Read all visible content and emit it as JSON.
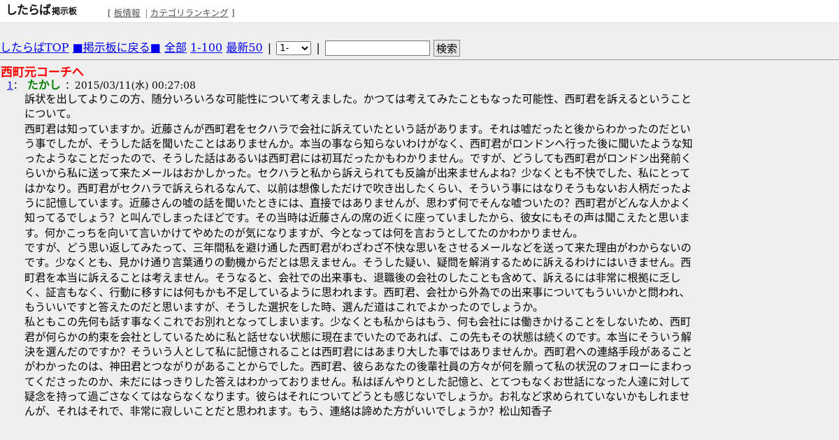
{
  "header": {
    "logo_main": "したらば",
    "logo_sub": "掲示板",
    "bracket_open": "[",
    "bracket_close": "]",
    "link_board_info": "板情報",
    "separator": "|",
    "link_category_ranking": "カテゴリランキング"
  },
  "nav": {
    "top": "したらばTOP",
    "back": "■掲示板に戻る■",
    "all": "全部",
    "range": "1-100",
    "latest": "最新50",
    "pipe": "|",
    "select_value": "1-",
    "search_value": "",
    "search_button": "検索"
  },
  "thread": {
    "title": "西町元コーチへ",
    "post": {
      "number": "1",
      "colon": "：",
      "name": "たかし",
      "datetime": "：2015/03/11(水) 00:27:08",
      "body": "訴状を出してよりこの方、随分いろいろな可能性について考えました。かつては考えてみたこともなった可能性、西町君を訴えるということについて。\n西町君は知っていますか。近藤さんが西町君をセクハラで会社に訴えていたという話があります。それは嘘だったと後からわかったのだという事でしたが、そうした話を聞いたことはありませんか。本当の事なら知らないわけがなく、西町君がロンドンへ行った後に聞いたような知ったようなことだったので、そうした話はあるいは西町君には初耳だったかもわかりません。ですが、どうしても西町君がロンドン出発前くらいから私に送って来たメールはおかしかった。セクハラと私から訴えられても反論が出来ませんよね？少なくとも不快でした、私にとってはかなり。西町君がセクハラで訴えられるなんて、以前は想像しただけで吹き出したくらい、そういう事にはなりそうもないお人柄だったように記憶しています。近藤さんの嘘の話を聞いたときには、直接ではありませんが、思わず何でそんな嘘ついたの？西町君がどんな人かよく知ってるでしょう？と叫んでしまったほどです。その当時は近藤さんの席の近くに座っていましたから、彼女にもその声は聞こえたと思います。何かこっちを向いて言いかけてやめたのが気になりますが、今となっては何を言おうとしてたのかわかりません。\nですが、どう思い返してみたって、三年間私を避け通した西町君がわざわざ不快な思いをさせるメールなどを送って来た理由がわからないのです。少なくとも、見かけ通り言葉通りの動機からだとは思えません。そうした疑い、疑問を解消するために訴えるわけにはいきません。西町君を本当に訴えることは考えません。そうなると、会社での出来事も、退職後の会社のしたことも含めて、訴えるには非常に根拠に乏しく、証言もなく、行動に移すには何もかも不足しているように思われます。西町君、会社から外為での出来事についてもういいかと問われ、もういいですと答えたのだと思いますが、そうした選択をした時、選んだ道はこれでよかったのでしょうか。\n私ともこの先何も話す事なくこれでお別れとなってしまいます。少なくとも私からはもう、何も会社には働きかけることをしないため、西町君が何らかの約束を会社としているために私と話せない状態に現在までいたのであれば、この先もその状態は続くのです。本当にそういう解決を選んだのですか？そういう人として私に記憶されることは西町君にはあまり大した事ではありませんか。西町君への連絡手段があることがわかったのは、神田君とつながりがあることからでした。西町君、彼らあなたの後輩社員の方々が何を願って私の状況のフォローにまわってくださったのか、未だにはっきりした答えはわかっておりません。私はぼんやりとした記憶と、とてつもなくお世話になった人達に対して疑念を持って過ごさなくてはならなくなります。彼らはそれについてどうとも感じないでしょうか。お礼など求められていないかもしれませんが、それはそれで、非常に寂しいことだと思われます。もう、連絡は諦めた方がいいでしょうか？松山知香子"
    }
  }
}
